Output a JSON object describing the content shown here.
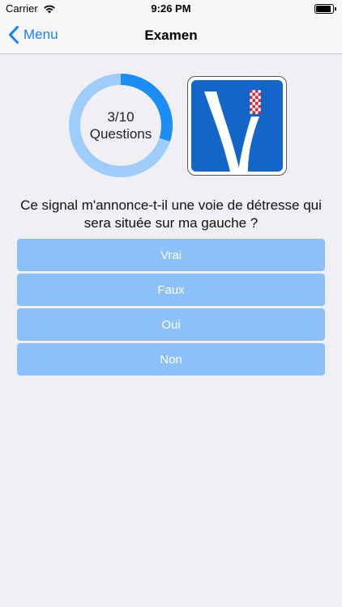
{
  "status_bar": {
    "carrier": "Carrier",
    "time": "9:26 PM"
  },
  "nav": {
    "back_label": "Menu",
    "title": "Examen"
  },
  "progress": {
    "current": 3,
    "total": 10,
    "count_label": "3/10",
    "unit_label": "Questions",
    "track_color": "#9fcdfb",
    "fill_color": "#1b8df4"
  },
  "question": {
    "text": "Ce signal m'annonce-t-il une voie de détresse qui sera située sur ma gauche ?"
  },
  "answers": [
    {
      "label": "Vrai"
    },
    {
      "label": "Faux"
    },
    {
      "label": "Oui"
    },
    {
      "label": "Non"
    }
  ],
  "colors": {
    "accent": "#1580f9",
    "answer_bg": "#8cc0fb",
    "background": "#efeff4",
    "sign_blue": "#1266c9"
  }
}
